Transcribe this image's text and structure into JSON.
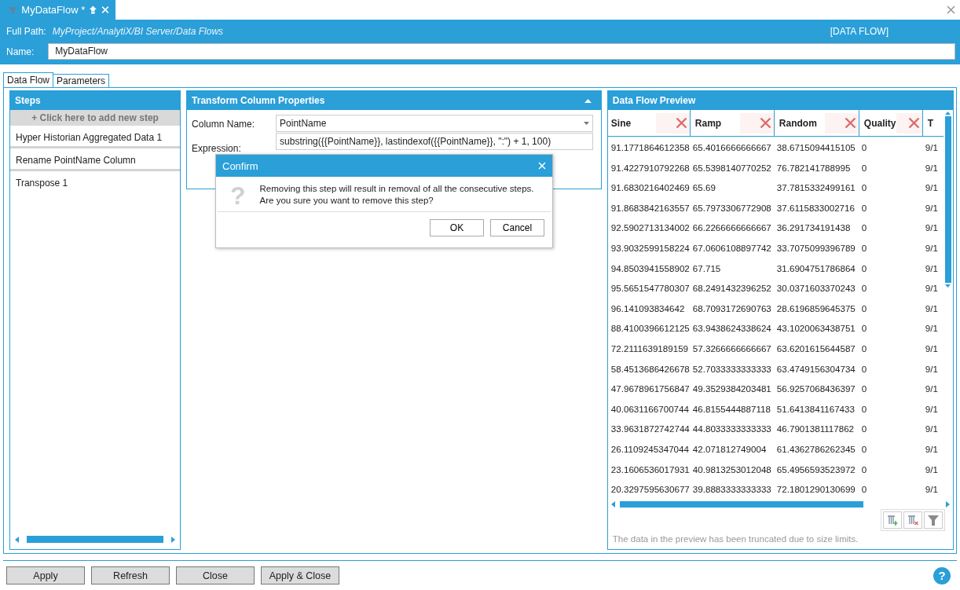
{
  "document_tab": {
    "title": "MyDataFlow *"
  },
  "header": {
    "path_label": "Full Path:",
    "path": "MyProject/AnalytiX/BI Server/Data Flows",
    "type": "[DATA FLOW]",
    "name_label": "Name:",
    "name": "MyDataFlow"
  },
  "tabs": [
    {
      "label": "Data Flow",
      "selected": true
    },
    {
      "label": "Parameters",
      "selected": false
    }
  ],
  "steps": {
    "title": "Steps",
    "add_label": "+  Click here to add new step",
    "items": [
      {
        "label": "Hyper Historian Aggregated Data  1"
      },
      {
        "label": "Rename PointName Column"
      },
      {
        "label": "Transpose  1"
      }
    ]
  },
  "transform": {
    "title": "Transform Column Properties",
    "column_name_label": "Column Name:",
    "column_name": "PointName",
    "expression_label": "Expression:",
    "expression": "substring({{PointName}}, lastindexof({{PointName}}, \":\") + 1, 100)"
  },
  "preview": {
    "title": "Data Flow Preview",
    "columns": [
      {
        "label": "Sine",
        "removable": true
      },
      {
        "label": "Ramp",
        "removable": true
      },
      {
        "label": "Random",
        "removable": true
      },
      {
        "label": "Quality",
        "removable": true
      },
      {
        "label": "T",
        "removable": false
      }
    ],
    "rows": [
      [
        "91.1771864612358",
        "65.4016666666667",
        "38.6715094415105",
        "0",
        "9/1"
      ],
      [
        "91.4227910792268",
        "65.5398140770252",
        "76.782141788995",
        "0",
        "9/1"
      ],
      [
        "91.6830216402469",
        "65.69",
        "37.7815332499161",
        "0",
        "9/1"
      ],
      [
        "91.8683842163557",
        "65.7973306772908",
        "37.6115833002716",
        "0",
        "9/1"
      ],
      [
        "92.5902713134002",
        "66.2266666666667",
        "36.291734191438",
        "0",
        "9/1"
      ],
      [
        "93.9032599158224",
        "67.0606108897742",
        "33.7075099396789",
        "0",
        "9/1"
      ],
      [
        "94.8503941558902",
        "67.715",
        "31.6904751786864",
        "0",
        "9/1"
      ],
      [
        "95.5651547780307",
        "68.2491432396252",
        "30.0371603370243",
        "0",
        "9/1"
      ],
      [
        "96.141093834642",
        "68.7093172690763",
        "28.6196859645375",
        "0",
        "9/1"
      ],
      [
        "88.4100396612125",
        "63.9438624338624",
        "43.1020063438751",
        "0",
        "9/1"
      ],
      [
        "72.2111639189159",
        "57.3266666666667",
        "63.6201615644587",
        "0",
        "9/1"
      ],
      [
        "58.4513686426678",
        "52.7033333333333",
        "63.4749156304734",
        "0",
        "9/1"
      ],
      [
        "47.9678961756847",
        "49.3529384203481",
        "56.9257068436397",
        "0",
        "9/1"
      ],
      [
        "40.0631166700744",
        "46.8155444887118",
        "51.6413841167433",
        "0",
        "9/1"
      ],
      [
        "33.9631872742744",
        "44.8033333333333",
        "46.7901381117862",
        "0",
        "9/1"
      ],
      [
        "26.1109245347044",
        "42.071812749004",
        "61.4362786262345",
        "0",
        "9/1"
      ],
      [
        "23.1606536017931",
        "40.9813253012048",
        "65.4956593523972",
        "0",
        "9/1"
      ],
      [
        "20.3297595630677",
        "39.8883333333333",
        "72.1801290130699",
        "0",
        "9/1"
      ]
    ],
    "note": "The data in the preview has been truncated due to size limits."
  },
  "buttons": [
    {
      "label": "Apply"
    },
    {
      "label": "Refresh"
    },
    {
      "label": "Close"
    },
    {
      "label": "Apply & Close"
    }
  ],
  "help": "?",
  "dialog": {
    "title": "Confirm",
    "icon": "?",
    "message": "Removing this step will result in removal of all the consecutive steps.\n Are you sure you want to remove this step?",
    "buttons": [
      {
        "label": "OK"
      },
      {
        "label": "Cancel"
      }
    ]
  }
}
